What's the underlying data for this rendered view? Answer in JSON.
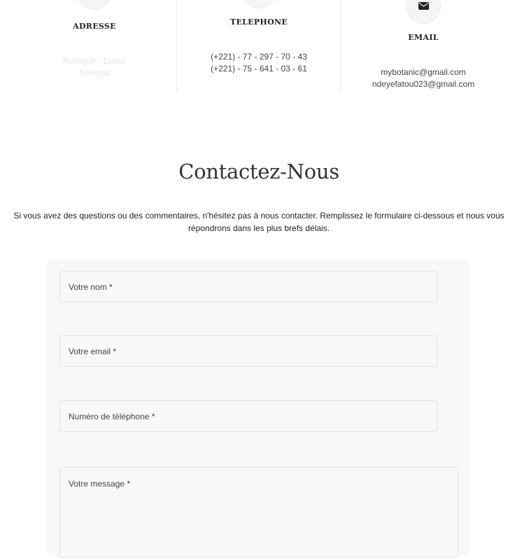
{
  "info": {
    "address": {
      "title": "ADRESSE",
      "line1": "Rufisque - Dakar",
      "line2": "Senegal"
    },
    "phone": {
      "title": "TELEPHONE",
      "line1": "(+221) - 77 - 297 - 70 - 43",
      "line2": "(+221) - 75 - 641 - 03 - 61"
    },
    "email": {
      "title": "EMAIL",
      "line1": "mybotanic@gmail.com",
      "line2": "ndeyefatou023@gmail.com",
      "icon": "envelope-icon"
    }
  },
  "contact": {
    "title": "Contactez-Nous",
    "intro": "Si vous avez des questions ou des commentaires, n'hésitez pas à nous contacter. Remplissez le formulaire ci-dessous et nous vous répondrons dans les plus brefs délais."
  },
  "form": {
    "name_placeholder": "Votre nom *",
    "email_placeholder": "Votre email *",
    "phone_placeholder": "Numéro de téléphone *",
    "message_placeholder": "Votre message *"
  }
}
